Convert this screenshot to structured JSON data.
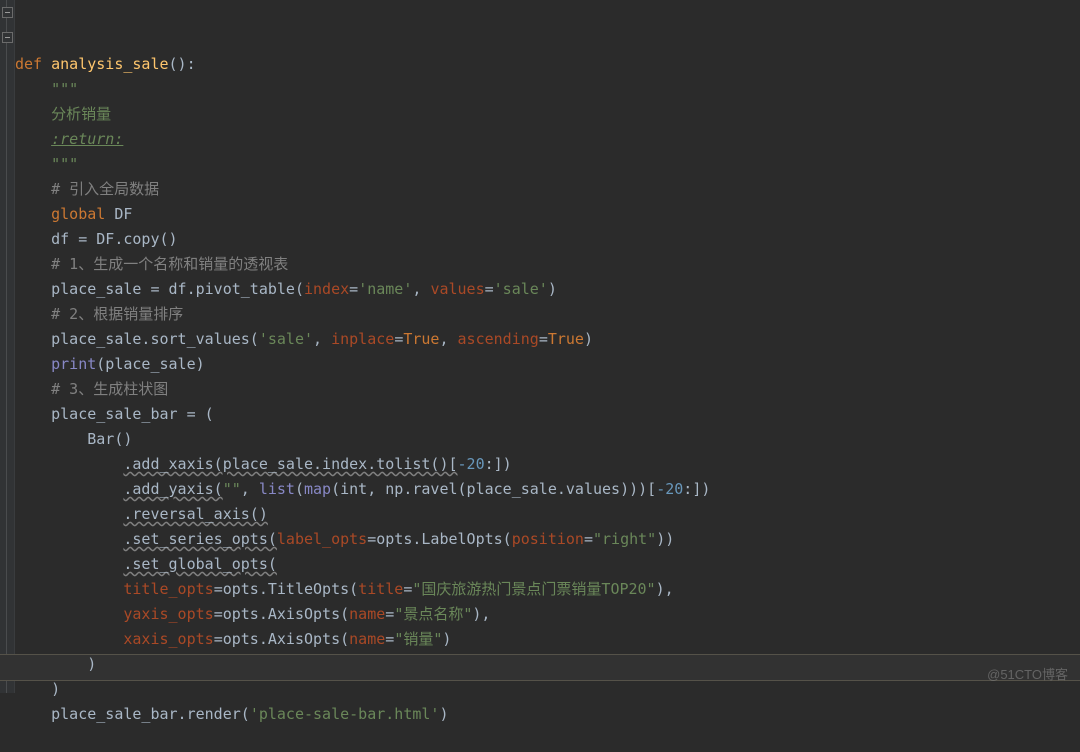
{
  "watermark": "@51CTO博客",
  "code": {
    "l1": {
      "def": "def ",
      "fn": "analysis_sale",
      "rest": "():"
    },
    "l2": "\"\"\"",
    "l3": "分析销量",
    "l4": {
      "tag": ":return:",
      "rest": ""
    },
    "l5": "\"\"\"",
    "l6": "# 引入全局数据",
    "l7": {
      "kw": "global ",
      "id": "DF"
    },
    "l8": {
      "a": "df = DF.copy()"
    },
    "l9": "# 1、生成一个名称和销量的透视表",
    "l10": {
      "a": "place_sale = df.pivot_table(",
      "k1": "index",
      "s1": "'name'",
      "k2": "values",
      "s2": "'sale'",
      "end": ")"
    },
    "l11": "# 2、根据销量排序",
    "l12": {
      "a": "place_sale.sort_values(",
      "s1": "'sale'",
      "k1": "inplace",
      "v1": "True",
      "k2": "ascending",
      "v2": "True",
      "end": ")"
    },
    "l13": {
      "a": "print(place_sale)"
    },
    "l14": "# 3、生成柱状图",
    "l15": "place_sale_bar = (",
    "l16": "Bar()",
    "l17": {
      "a": ".add_xaxis(place_sale.index.tolist()[",
      "n1": "-20",
      "rest": ":])"
    },
    "l18": {
      "a": ".add_yaxis(",
      "s0": "\"\"",
      "mid": ", ",
      "b": "list",
      "paren": "(",
      "m": "map",
      "args": "(int, np.ravel(place_sale.values)))[",
      "n1": "-20",
      "rest": ":])"
    },
    "l19": ".reversal_axis()",
    "l20": {
      "a": ".set_series_opts(",
      "k1": "label_opts",
      "mid": "=opts.LabelOpts(",
      "k2": "position",
      "s1": "\"right\"",
      "end": "))"
    },
    "l21": ".set_global_opts(",
    "l22": {
      "k1": "title_opts",
      "mid": "=opts.TitleOpts(",
      "k2": "title",
      "s1": "\"国庆旅游热门景点门票销量TOP20\"",
      "end": "),"
    },
    "l23": {
      "k1": "yaxis_opts",
      "mid": "=opts.AxisOpts(",
      "k2": "name",
      "s1": "\"景点名称\"",
      "end": "),"
    },
    "l24": {
      "k1": "xaxis_opts",
      "mid": "=opts.AxisOpts(",
      "k2": "name",
      "s1": "\"销量\"",
      "end": ")"
    },
    "l25": ")",
    "l26": ")",
    "l27": {
      "a": "place_sale_bar.render(",
      "s1": "'place-sale-bar.html'",
      "end": ")"
    }
  }
}
